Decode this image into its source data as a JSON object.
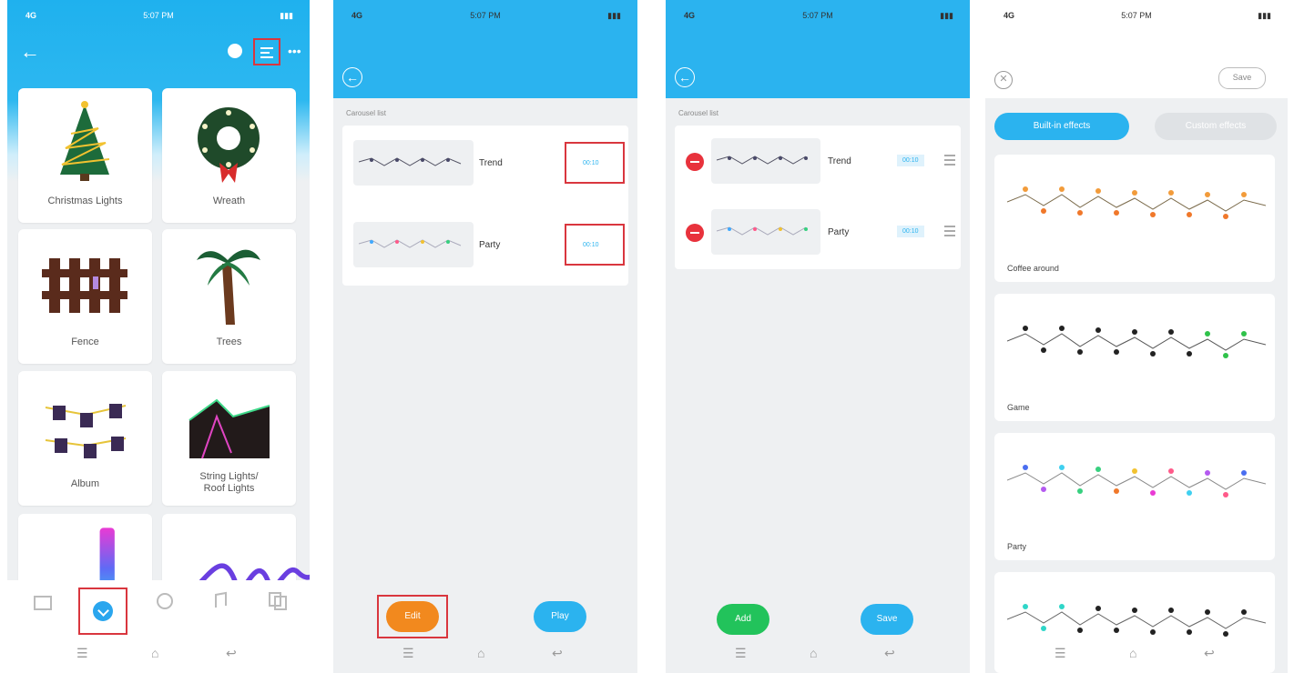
{
  "colors": {
    "accent": "#2bb3ef",
    "highlight": "#d9363e",
    "edit": "#f2891e",
    "add": "#22c35b"
  },
  "status": {
    "time": "5:07 PM"
  },
  "screen1": {
    "tiles": [
      {
        "label": "Christmas Lights"
      },
      {
        "label": "Wreath"
      },
      {
        "label": "Fence"
      },
      {
        "label": "Trees"
      },
      {
        "label": "Album"
      },
      {
        "label": "String Lights/\nRoof Lights"
      }
    ],
    "tabs": [
      "home-icon",
      "effects-icon",
      "scene-icon",
      "music-icon",
      "pictures-icon"
    ]
  },
  "screen2": {
    "section": "Carousel list",
    "rows": [
      {
        "name": "Trend",
        "time": "00:10"
      },
      {
        "name": "Party",
        "time": "00:10"
      }
    ],
    "edit_label": "Edit",
    "play_label": "Play"
  },
  "screen3": {
    "section": "Carousel list",
    "rows": [
      {
        "name": "Trend",
        "time": "00:10"
      },
      {
        "name": "Party",
        "time": "00:10"
      }
    ],
    "add_label": "Add",
    "save_label": "Save"
  },
  "screen4": {
    "save_label": "Save",
    "tab_builtin": "Built-in effects",
    "tab_custom": "Custom effects",
    "effects": [
      {
        "name": "Coffee around"
      },
      {
        "name": "Game"
      },
      {
        "name": "Party"
      },
      {
        "name": ""
      }
    ]
  }
}
